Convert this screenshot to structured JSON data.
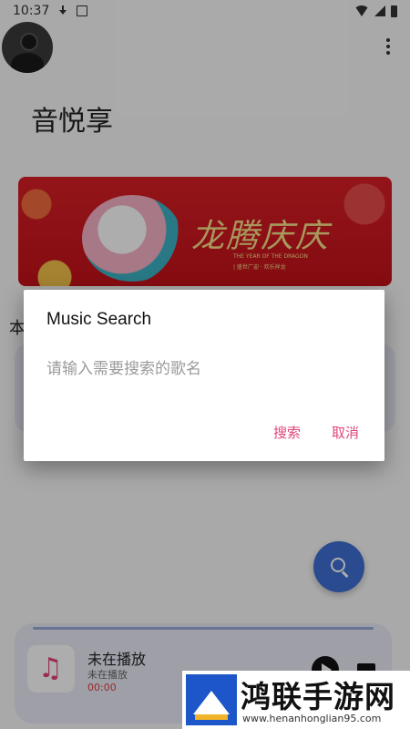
{
  "status_bar": {
    "time": "10:37",
    "icons": [
      "download-icon",
      "image-icon",
      "wifi-icon",
      "cellular-icon",
      "battery-icon"
    ]
  },
  "header": {
    "avatar_icon": "user-avatar-icon",
    "more_icon": "more-vert-icon",
    "app_title": "音悦享"
  },
  "banner": {
    "headline": "龙腾庆庆",
    "english_line": "THE YEAR OF THE DRAGON",
    "sub_line": "| 盛世广迎 · 欢乐祥龙"
  },
  "section": {
    "title_visible": "本"
  },
  "dialog": {
    "title": "Music Search",
    "input_placeholder": "请输入需要搜索的歌名",
    "input_value": "",
    "search_button": "搜索",
    "cancel_button": "取消",
    "accent_color": "#e2457a"
  },
  "fab": {
    "icon": "search-icon",
    "color": "#3f6fd4"
  },
  "player": {
    "album_icon": "music-note-icon",
    "title": "未在播放",
    "subtitle": "未在播放",
    "time": "00:00",
    "play_icon": "play-icon",
    "queue_icon": "queue-music-icon"
  },
  "watermark": {
    "title": "鸿联手游网",
    "url": "www.henanhonglian95.com"
  }
}
